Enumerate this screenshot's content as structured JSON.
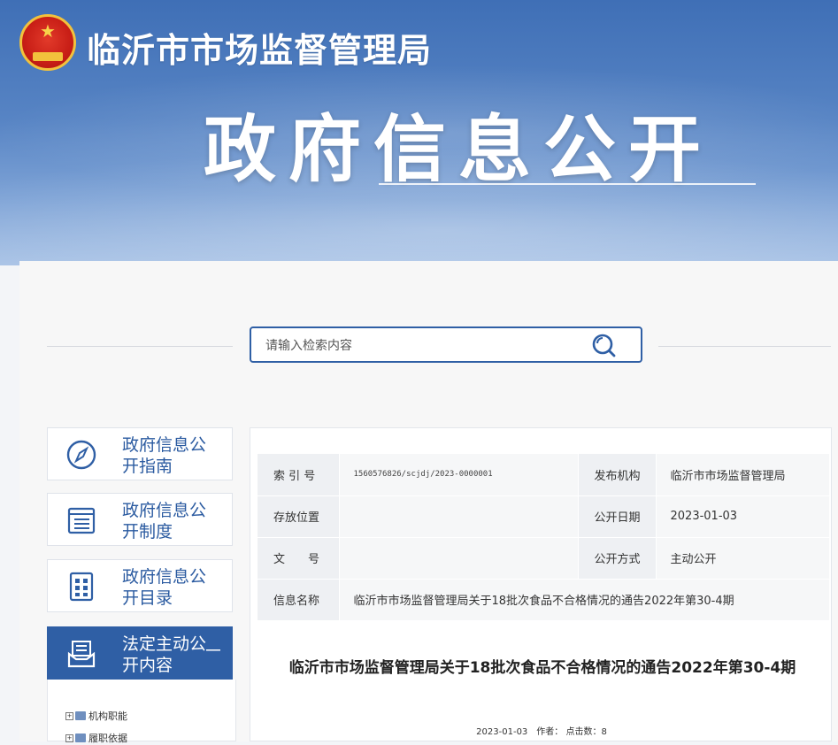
{
  "header": {
    "site_title": "临沂市市场监督管理局",
    "banner_title": "政府信息公开"
  },
  "search": {
    "placeholder": "请输入检索内容"
  },
  "sidebar": {
    "items": [
      {
        "label": "政府信息公开指南",
        "icon": "compass-icon"
      },
      {
        "label": "政府信息公开制度",
        "icon": "document-list-icon"
      },
      {
        "label": "政府信息公开目录",
        "icon": "grid-catalog-icon"
      },
      {
        "label": "法定主动公开内容",
        "icon": "inbox-icon",
        "active": true,
        "toggle": "－"
      }
    ],
    "tree": [
      {
        "label": "机构职能"
      },
      {
        "label": "履职依据"
      }
    ]
  },
  "meta_table": {
    "rows": [
      {
        "k1": "索 引 号",
        "v1": "1560576826/scjdj/2023-0000001",
        "k2": "发布机构",
        "v2": "临沂市市场监督管理局"
      },
      {
        "k1": "存放位置",
        "v1": "",
        "k2": "公开日期",
        "v2": "2023-01-03"
      },
      {
        "k1": "文　　号",
        "v1": "",
        "k2": "公开方式",
        "v2": "主动公开"
      }
    ],
    "name_label": "信息名称",
    "name_value": "临沂市市场监督管理局关于18批次食品不合格情况的通告2022年第30-4期"
  },
  "article": {
    "title": "临沂市市场监督管理局关于18批次食品不合格情况的通告2022年第30-4期",
    "meta": "2023-01-03　作者：  点击数：8"
  },
  "colors": {
    "primary": "#2f5fa5",
    "banner": "#4a78bc"
  }
}
